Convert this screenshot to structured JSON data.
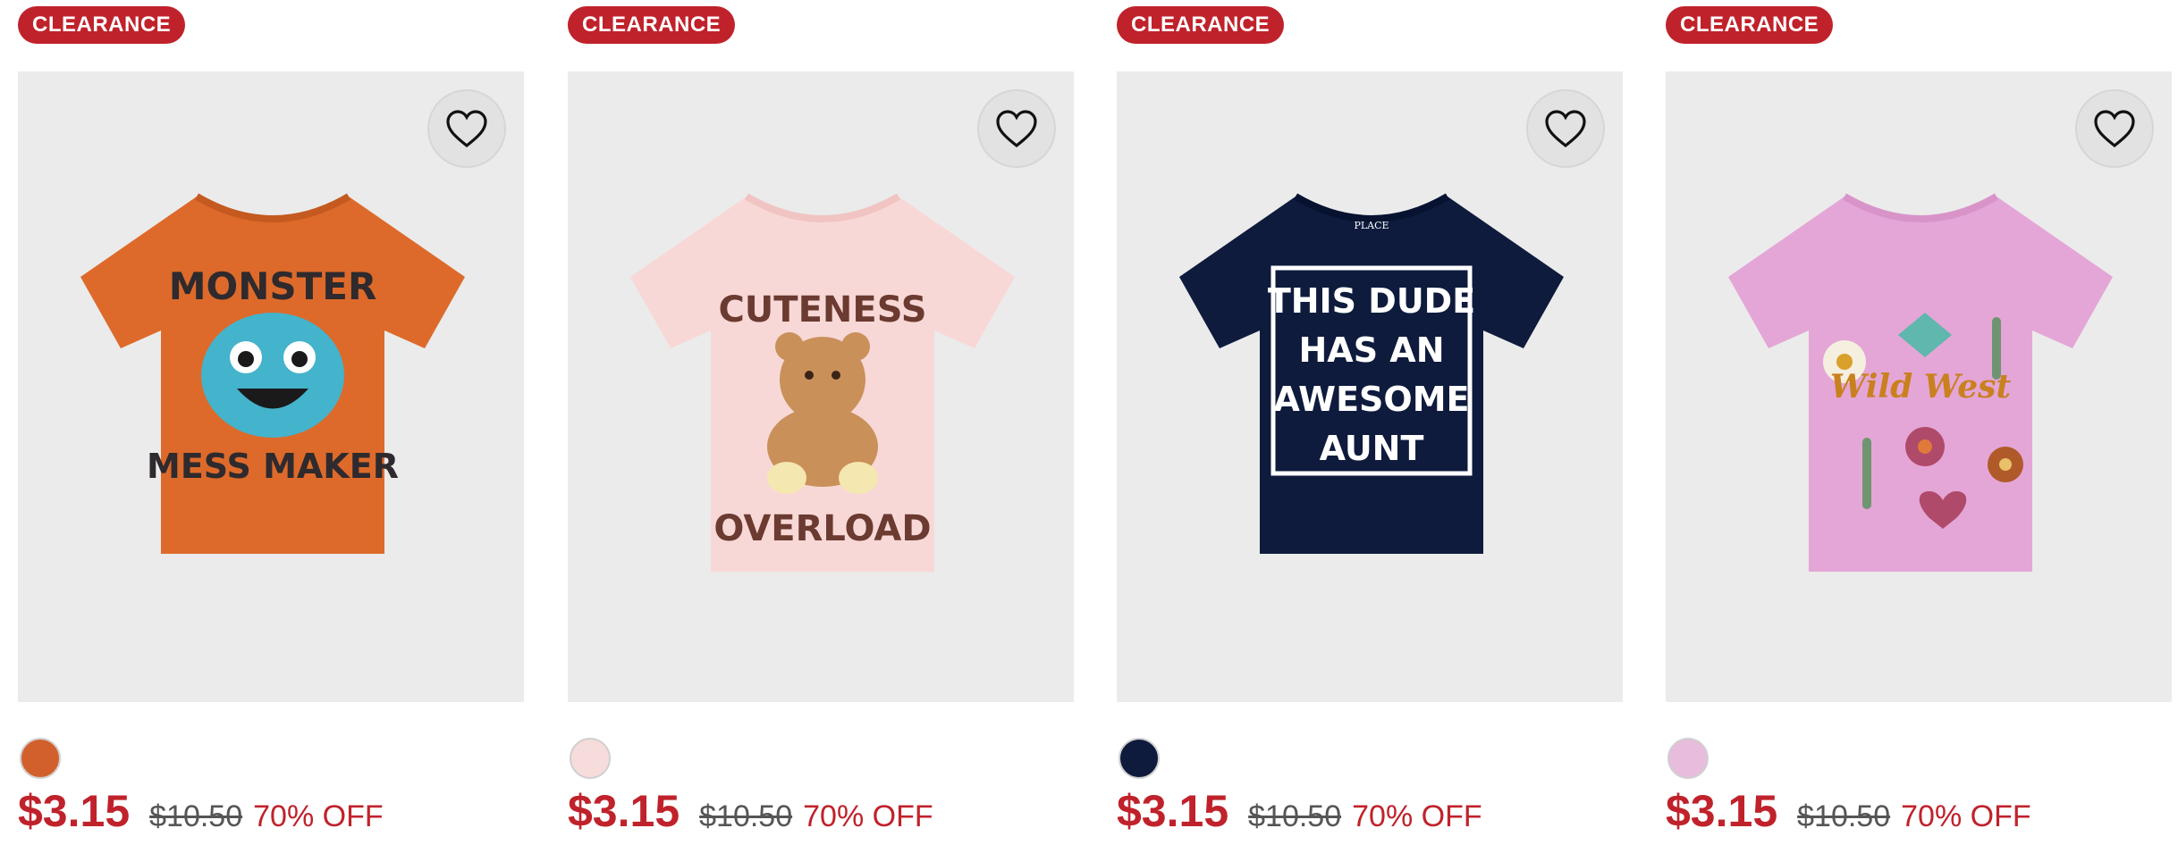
{
  "products": [
    {
      "badge": "CLEARANCE",
      "sale_price": "$3.15",
      "original_price": "$10.50",
      "discount": "70% OFF",
      "shirt_color": "#dd6a2a",
      "swatch_color": "#d2602c",
      "graphic_lines": [
        "MONSTER",
        "MESS MAKER"
      ],
      "wishlist_icon": "heart-outline-icon"
    },
    {
      "badge": "CLEARANCE",
      "sale_price": "$3.15",
      "original_price": "$10.50",
      "discount": "70% OFF",
      "shirt_color": "#f8d8d6",
      "swatch_color": "#f6dcda",
      "graphic_lines": [
        "CUTENESS",
        "OVERLOAD"
      ],
      "wishlist_icon": "heart-outline-icon"
    },
    {
      "badge": "CLEARANCE",
      "sale_price": "$3.15",
      "original_price": "$10.50",
      "discount": "70% OFF",
      "shirt_color": "#0e1b3d",
      "swatch_color": "#0e1b3d",
      "graphic_lines": [
        "THIS DUDE",
        "HAS AN",
        "AWESOME",
        "AUNT"
      ],
      "shirt_tag": "PLACE",
      "wishlist_icon": "heart-outline-icon"
    },
    {
      "badge": "CLEARANCE",
      "sale_price": "$3.15",
      "original_price": "$10.50",
      "discount": "70% OFF",
      "shirt_color": "#e4a6d6",
      "swatch_color": "#e8bcdc",
      "graphic_lines": [
        "Wild West"
      ],
      "wishlist_icon": "heart-outline-icon"
    }
  ]
}
